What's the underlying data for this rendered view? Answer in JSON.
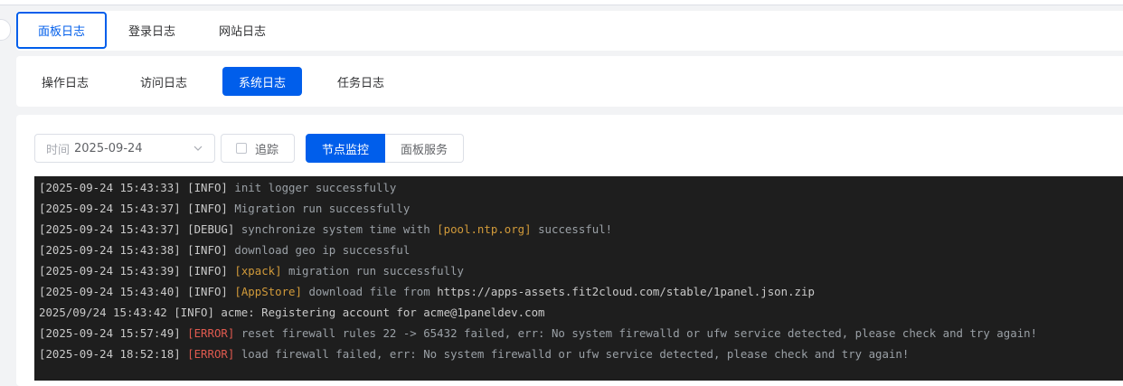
{
  "top_tabs": [
    {
      "label": "面板日志",
      "active": true
    },
    {
      "label": "登录日志",
      "active": false
    },
    {
      "label": "网站日志",
      "active": false
    }
  ],
  "sub_tabs": [
    {
      "label": "操作日志",
      "active": false
    },
    {
      "label": "访问日志",
      "active": false
    },
    {
      "label": "系统日志",
      "active": true
    },
    {
      "label": "任务日志",
      "active": false
    }
  ],
  "toolbar": {
    "date_label": "时间",
    "date_value": "2025-09-24",
    "follow_label": "追踪",
    "follow_checked": false,
    "source_options": [
      {
        "label": "节点监控",
        "active": true
      },
      {
        "label": "面板服务",
        "active": false
      }
    ]
  },
  "colors": {
    "accent": "#005eeb",
    "console_bg": "#1e1e1e",
    "highlight": "#d19a3a",
    "error": "#e05a4f"
  },
  "log_lines": [
    {
      "ts": "[2025-09-24 15:43:33]",
      "level": "[INFO]",
      "tag": "",
      "msg": "init logger successfully"
    },
    {
      "ts": "[2025-09-24 15:43:37]",
      "level": "[INFO]",
      "tag": "",
      "msg": "Migration run successfully"
    },
    {
      "ts": "[2025-09-24 15:43:37]",
      "level": "[DEBUG]",
      "pre": "synchronize system time with",
      "tag": "[pool.ntp.org]",
      "msg": "successful!"
    },
    {
      "ts": "[2025-09-24 15:43:38]",
      "level": "[INFO]",
      "tag": "",
      "msg": "download geo ip successful"
    },
    {
      "ts": "[2025-09-24 15:43:39]",
      "level": "[INFO]",
      "tag": "[xpack]",
      "msg": "migration run successfully"
    },
    {
      "ts": "[2025-09-24 15:43:40]",
      "level": "[INFO]",
      "tag": "[AppStore]",
      "msg": "download file from",
      "url": "https://apps-assets.fit2cloud.com/stable/1panel.json.zip"
    },
    {
      "plain": "2025/09/24 15:43:42 [INFO] acme: Registering account for acme@1paneldev.com"
    },
    {
      "ts": "[2025-09-24 15:57:49]",
      "level": "[ERROR]",
      "tag": "",
      "msg": "reset firewall rules 22 -> 65432 failed, err: No system firewalld or ufw service detected, please check and try again!"
    },
    {
      "ts": "[2025-09-24 18:52:18]",
      "level": "[ERROR]",
      "tag": "",
      "msg": "load firewall failed, err: No system firewalld or ufw service detected, please check and try again!"
    }
  ]
}
